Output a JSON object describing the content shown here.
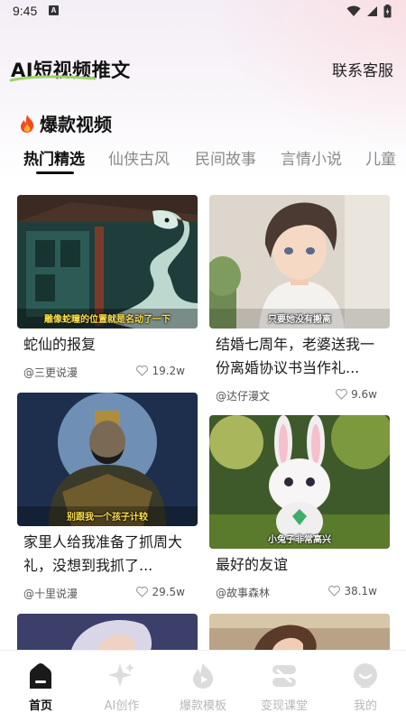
{
  "status_bar": {
    "time": "9:45",
    "notification_badge": "A"
  },
  "header": {
    "app_title": "AI短视频推文",
    "contact_label": "联系客服"
  },
  "section": {
    "title": "爆款视频",
    "icon": "fire-icon"
  },
  "tabs": [
    {
      "label": "热门精选",
      "active": true
    },
    {
      "label": "仙侠古风",
      "active": false
    },
    {
      "label": "民间故事",
      "active": false
    },
    {
      "label": "言情小说",
      "active": false
    },
    {
      "label": "儿童",
      "active": false
    }
  ],
  "cards": [
    {
      "thumb_caption": "雕像蛇瞳的位置就是名动了一下",
      "title": "蛇仙的报复",
      "author": "@三更说漫",
      "likes": "19.2w"
    },
    {
      "thumb_caption": "只要她没有搬离",
      "title": "结婚七周年，老婆送我一份离婚协议书当作礼...",
      "author": "@达仔漫文",
      "likes": "9.6w"
    },
    {
      "thumb_caption": "别跟我一个孩子计较",
      "title": "家里人给我准备了抓周大礼，没想到我抓了...",
      "author": "@十里说漫",
      "likes": "29.5w"
    },
    {
      "thumb_caption": "小兔子非常高兴",
      "title": "最好的友谊",
      "author": "@故事森林",
      "likes": "38.1w"
    },
    {
      "thumb_caption": ""
    },
    {
      "thumb_caption": ""
    }
  ],
  "bottom_nav": [
    {
      "label": "首页",
      "icon": "home-icon",
      "active": true
    },
    {
      "label": "AI创作",
      "icon": "sparkle-icon",
      "active": false
    },
    {
      "label": "爆款模板",
      "icon": "fire-template-icon",
      "active": false
    },
    {
      "label": "变现课堂",
      "icon": "classroom-icon",
      "active": false
    },
    {
      "label": "我的",
      "icon": "profile-icon",
      "active": false
    }
  ],
  "colors": {
    "accent_swoosh": "#9bd36a",
    "active_text": "#111111",
    "inactive_text": "#8a8a8a",
    "caption_yellow": "#ffe14a"
  }
}
